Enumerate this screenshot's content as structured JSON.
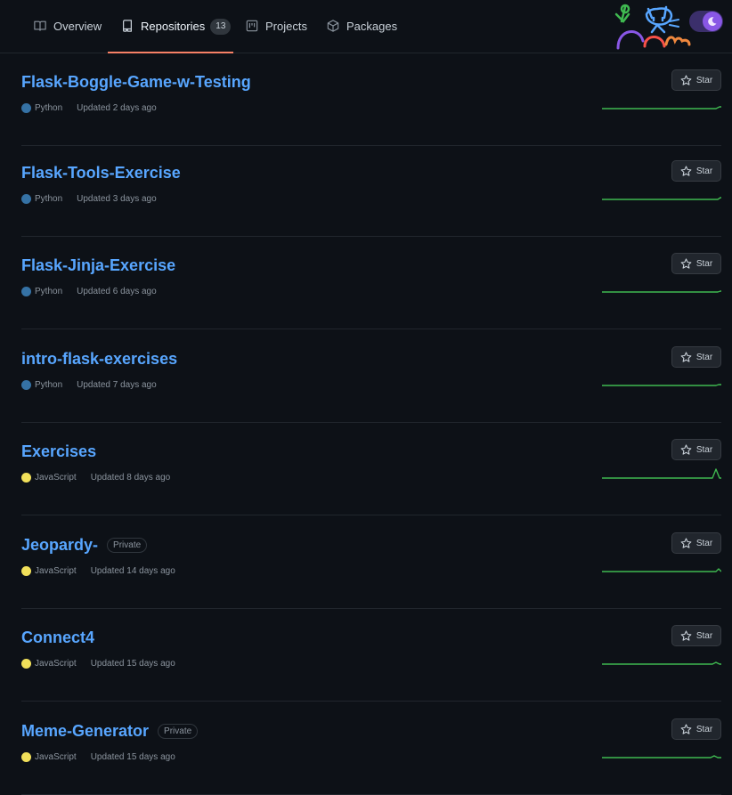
{
  "tabs": [
    {
      "label": "Overview",
      "icon": "book-icon"
    },
    {
      "label": "Repositories",
      "icon": "repo-icon",
      "count": "13",
      "active": true
    },
    {
      "label": "Projects",
      "icon": "project-icon"
    },
    {
      "label": "Packages",
      "icon": "package-icon"
    }
  ],
  "theme_toggle": {
    "icon": "moon-icon",
    "state": "dark"
  },
  "colors": {
    "python": "#3572A5",
    "javascript": "#f1e05a",
    "link": "#58a6ff",
    "spark": "#3fb950",
    "active_tab": "#f78166"
  },
  "repos": [
    {
      "name": "Flask-Boggle-Game-w-Testing",
      "language": "Python",
      "updated": "Updated 2 days ago",
      "star": "Star",
      "private": ""
    },
    {
      "name": "Flask-Tools-Exercise",
      "language": "Python",
      "updated": "Updated 3 days ago",
      "star": "Star",
      "private": ""
    },
    {
      "name": "Flask-Jinja-Exercise",
      "language": "Python",
      "updated": "Updated 6 days ago",
      "star": "Star",
      "private": ""
    },
    {
      "name": "intro-flask-exercises",
      "language": "Python",
      "updated": "Updated 7 days ago",
      "star": "Star",
      "private": ""
    },
    {
      "name": "Exercises",
      "language": "JavaScript",
      "updated": "Updated 8 days ago",
      "star": "Star",
      "private": ""
    },
    {
      "name": "Jeopardy-",
      "language": "JavaScript",
      "updated": "Updated 14 days ago",
      "star": "Star",
      "private": "Private"
    },
    {
      "name": "Connect4",
      "language": "JavaScript",
      "updated": "Updated 15 days ago",
      "star": "Star",
      "private": ""
    },
    {
      "name": "Meme-Generator",
      "language": "JavaScript",
      "updated": "Updated 15 days ago",
      "star": "Star",
      "private": "Private"
    }
  ]
}
